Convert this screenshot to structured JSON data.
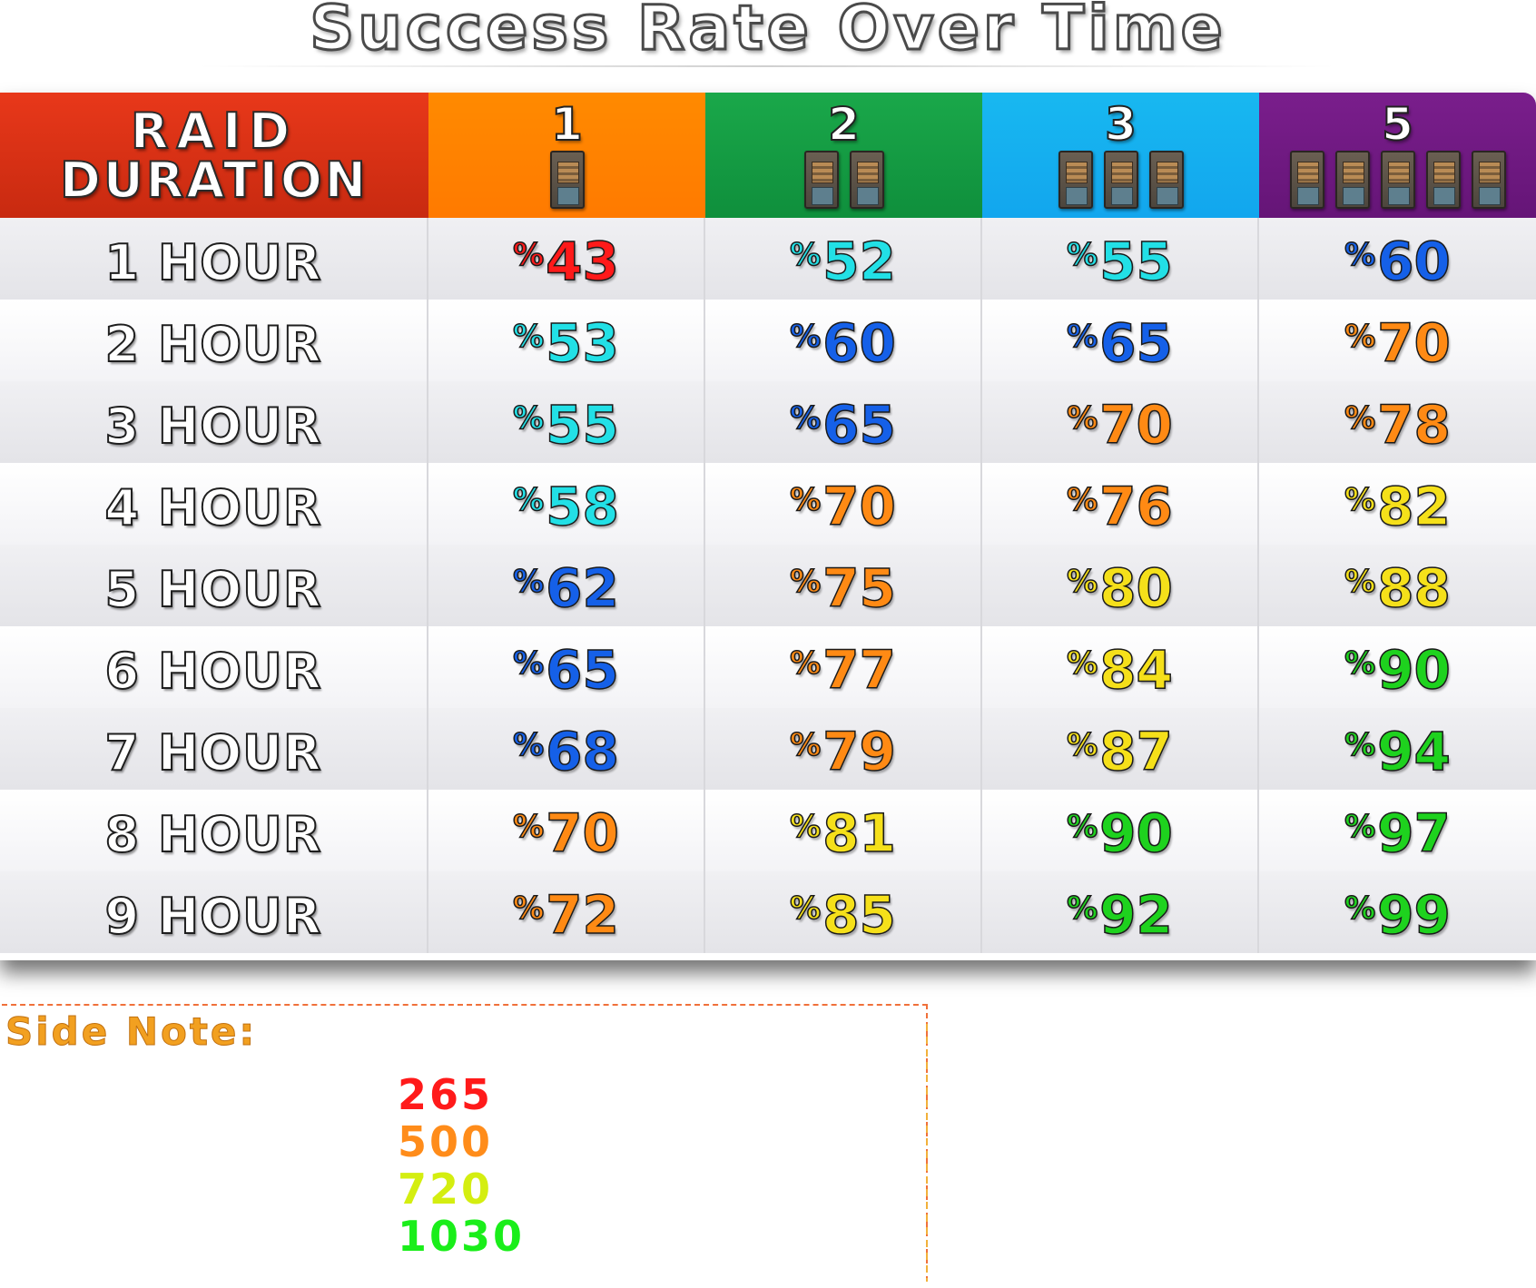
{
  "title": "Success Rate Over Time",
  "header": {
    "duration_line1": "RAID",
    "duration_line2": "DURATION",
    "columns": [
      {
        "count": "1",
        "doors": 1,
        "color_from": "#ff8a00",
        "color_to": "#ff7a00"
      },
      {
        "count": "2",
        "doors": 2,
        "color_from": "#1aa84a",
        "color_to": "#0f8f3c"
      },
      {
        "count": "3",
        "doors": 3,
        "color_from": "#18b8f0",
        "color_to": "#12a6ee"
      },
      {
        "count": "5",
        "doors": 5,
        "color_from": "#7a1e8c",
        "color_to": "#651577"
      }
    ],
    "duration_color_from": "#e8381a",
    "duration_color_to": "#c82a10"
  },
  "percent_symbol": "%",
  "chart_data": {
    "type": "table",
    "title": "Success Rate Over Time",
    "row_header": "RAID DURATION",
    "columns": [
      "1",
      "2",
      "3",
      "5"
    ],
    "rows": [
      {
        "duration": "1 HOUR",
        "values": [
          43,
          52,
          55,
          60
        ]
      },
      {
        "duration": "2 HOUR",
        "values": [
          53,
          60,
          65,
          70
        ]
      },
      {
        "duration": "3 HOUR",
        "values": [
          55,
          65,
          70,
          78
        ]
      },
      {
        "duration": "4 HOUR",
        "values": [
          58,
          70,
          76,
          82
        ]
      },
      {
        "duration": "5 HOUR",
        "values": [
          62,
          75,
          80,
          88
        ]
      },
      {
        "duration": "6 HOUR",
        "values": [
          65,
          77,
          84,
          90
        ]
      },
      {
        "duration": "7 HOUR",
        "values": [
          68,
          79,
          87,
          94
        ]
      },
      {
        "duration": "8 HOUR",
        "values": [
          70,
          81,
          90,
          97
        ]
      },
      {
        "duration": "9 HOUR",
        "values": [
          72,
          85,
          92,
          99
        ]
      }
    ]
  },
  "value_colors": {
    "red": "#ff1a1a",
    "cyan": "#22e0e6",
    "blue": "#1560e8",
    "orange": "#ff8a14",
    "yellow": "#f5e01a",
    "green": "#1ed21e"
  },
  "side_note": {
    "title": "Side Note:",
    "values": [
      {
        "text": "265",
        "color": "#ff1a1a"
      },
      {
        "text": "500",
        "color": "#ff8c1a"
      },
      {
        "text": "720",
        "color": "#d4ee10"
      },
      {
        "text": "1030",
        "color": "#1aee1a"
      }
    ]
  }
}
